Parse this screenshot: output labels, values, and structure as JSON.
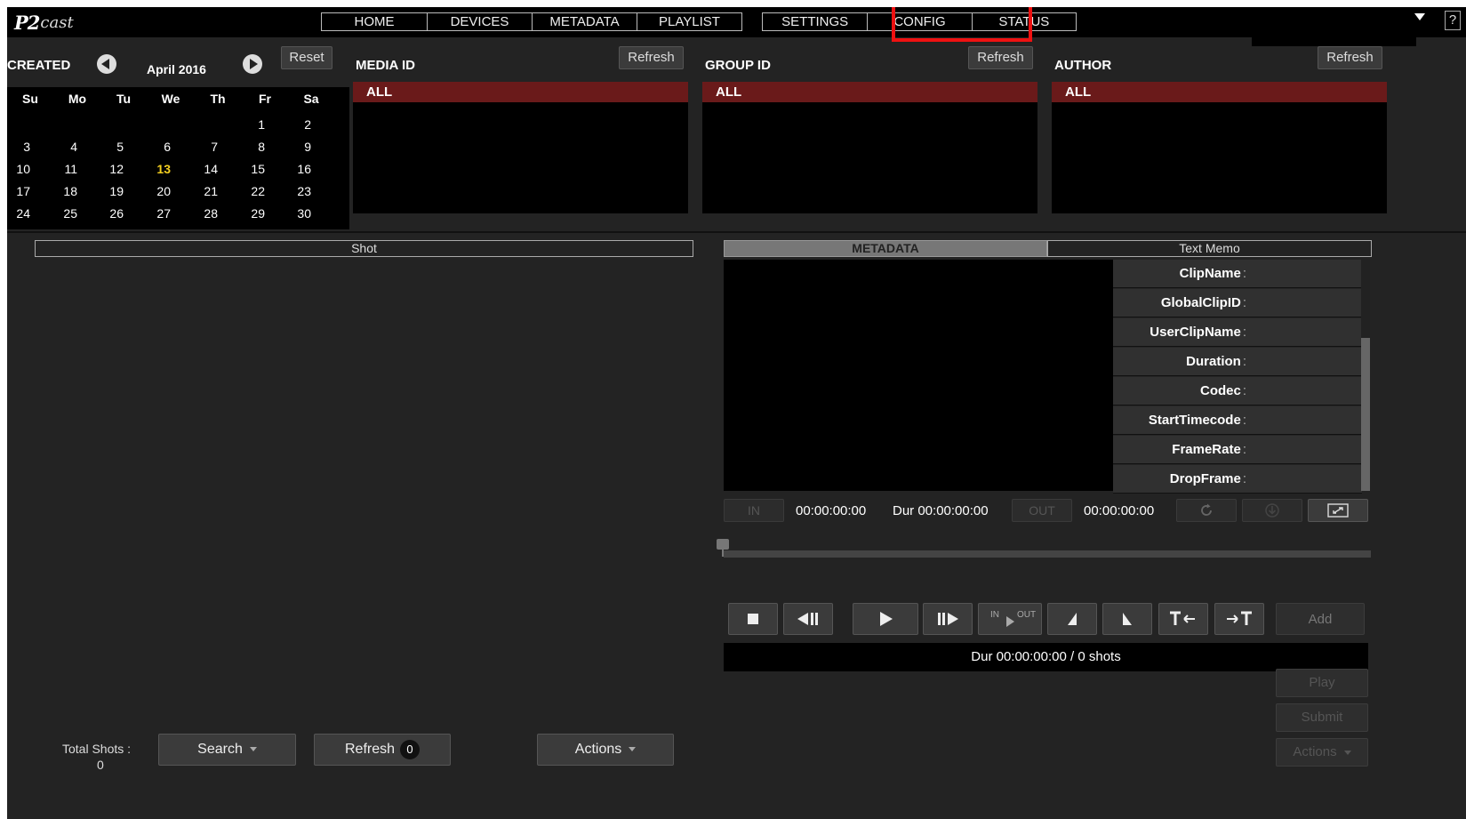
{
  "app": {
    "logo_p2": "P2",
    "logo_cast": "cast"
  },
  "nav": {
    "items": [
      "HOME",
      "DEVICES",
      "METADATA",
      "PLAYLIST"
    ],
    "items2": [
      "SETTINGS",
      "CONFIG",
      "STATUS"
    ],
    "help": "?"
  },
  "filters": {
    "created_label": "CREATED",
    "month": "April 2016",
    "reset": "Reset",
    "media_id_label": "MEDIA ID",
    "group_id_label": "GROUP ID",
    "author_label": "AUTHOR",
    "refresh": "Refresh",
    "all": "ALL"
  },
  "calendar": {
    "weekdays": [
      "Su",
      "Mo",
      "Tu",
      "We",
      "Th",
      "Fr",
      "Sa"
    ],
    "weeks": [
      [
        "",
        "",
        "",
        "",
        "",
        "1",
        "2"
      ],
      [
        "3",
        "4",
        "5",
        "6",
        "7",
        "8",
        "9"
      ],
      [
        "10",
        "11",
        "12",
        "13",
        "14",
        "15",
        "16"
      ],
      [
        "17",
        "18",
        "19",
        "20",
        "21",
        "22",
        "23"
      ],
      [
        "24",
        "25",
        "26",
        "27",
        "28",
        "29",
        "30"
      ]
    ],
    "today": "13"
  },
  "shots": {
    "header": "Shot",
    "total_label": "Total Shots :",
    "total_value": "0",
    "search": "Search",
    "refresh": "Refresh",
    "refresh_count": "0",
    "actions": "Actions"
  },
  "metadata": {
    "tab_active": "METADATA",
    "tab_inactive": "Text Memo",
    "fields": [
      "ClipName",
      "GlobalClipID",
      "UserClipName",
      "Duration",
      "Codec",
      "StartTimecode",
      "FrameRate",
      "DropFrame"
    ]
  },
  "player": {
    "in_label": "IN",
    "out_label": "OUT",
    "in_tc": "00:00:00:00",
    "dur_tc": "Dur 00:00:00:00",
    "out_tc": "00:00:00:00",
    "add": "Add",
    "inout_in": "IN",
    "inout_out": "OUT",
    "summary": "Dur 00:00:00:00 / 0 shots",
    "play": "Play",
    "submit": "Submit",
    "actions": "Actions"
  }
}
